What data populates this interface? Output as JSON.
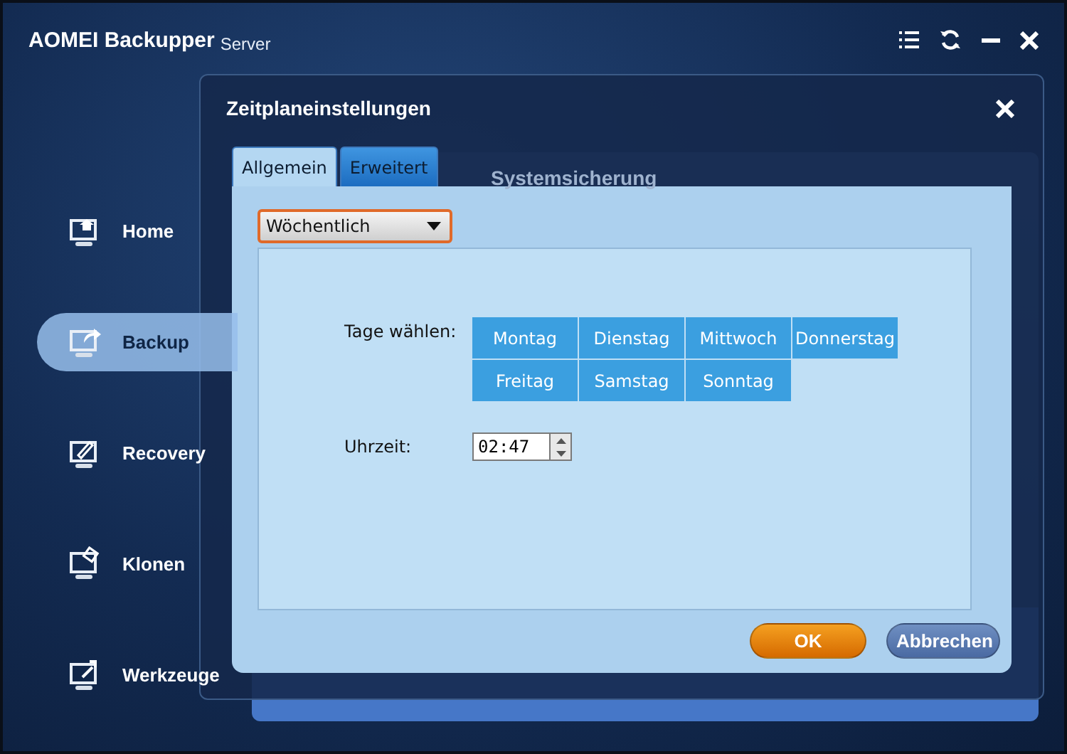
{
  "app": {
    "title": "AOMEI Backupper",
    "edition": "Server"
  },
  "sidebar": {
    "items": [
      {
        "label": "Home",
        "kind": "home",
        "selected": false
      },
      {
        "label": "Backup",
        "kind": "backup",
        "selected": true
      },
      {
        "label": "Recovery",
        "kind": "recovery",
        "selected": false
      },
      {
        "label": "Klonen",
        "kind": "clone",
        "selected": false
      },
      {
        "label": "Werkzeuge",
        "kind": "tools",
        "selected": false
      }
    ]
  },
  "background_panel": {
    "heading": "Systemsicherung"
  },
  "dialog": {
    "title": "Zeitplaneinstellungen",
    "tabs": [
      {
        "label": "Allgemein",
        "selected": true
      },
      {
        "label": "Erweitert",
        "selected": false
      }
    ],
    "frequency": {
      "value": "Wöchentlich"
    },
    "days_label": "Tage wählen:",
    "days": [
      "Montag",
      "Dienstag",
      "Mittwoch",
      "Donnerstag",
      "Freitag",
      "Samstag",
      "Sonntag"
    ],
    "time_label": "Uhrzeit:",
    "time": {
      "value": "02:47"
    },
    "buttons": [
      {
        "label": "OK",
        "kind": "primary"
      },
      {
        "label": "Abbrechen",
        "kind": "secondary"
      }
    ]
  }
}
